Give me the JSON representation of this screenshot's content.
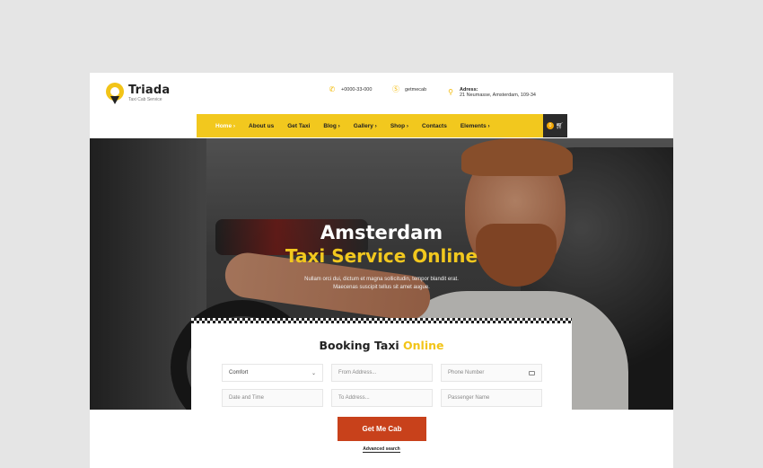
{
  "header": {
    "logo_title": "Triada",
    "logo_subtitle": "Taxi Cab Service",
    "phone": "+0000-33-000",
    "skype": "getmecab",
    "address_label": "Adress:",
    "address": "21 Neumasse, Amsterdam, 109-34"
  },
  "nav": {
    "items": [
      "Home ›",
      "About us",
      "Get Taxi",
      "Blog ›",
      "Gallery ›",
      "Shop ›",
      "Contacts",
      "Elements ›"
    ],
    "cart_count": "0"
  },
  "hero": {
    "title_line1": "Amsterdam",
    "title_line2": "Taxi Service Online",
    "text_line1": "Nullam orci dui, dictum et magna sollicitudin, tempor blandit erat.",
    "text_line2": "Maecenas suscipit tellus sit amet augue."
  },
  "booking": {
    "title": "Booking Taxi",
    "title_highlight": "Online",
    "car_type": "Comfort",
    "from_placeholder": "From Address...",
    "phone_placeholder": "Phone Number",
    "date_placeholder": "Date and Time",
    "to_placeholder": "To Address...",
    "passenger_placeholder": "Passenger Name",
    "submit_label": "Get Me Cab",
    "advanced_label": "Advanced search"
  },
  "colors": {
    "accent": "#f2c81e",
    "button": "#c8411b",
    "dark": "#2b2b2b"
  }
}
